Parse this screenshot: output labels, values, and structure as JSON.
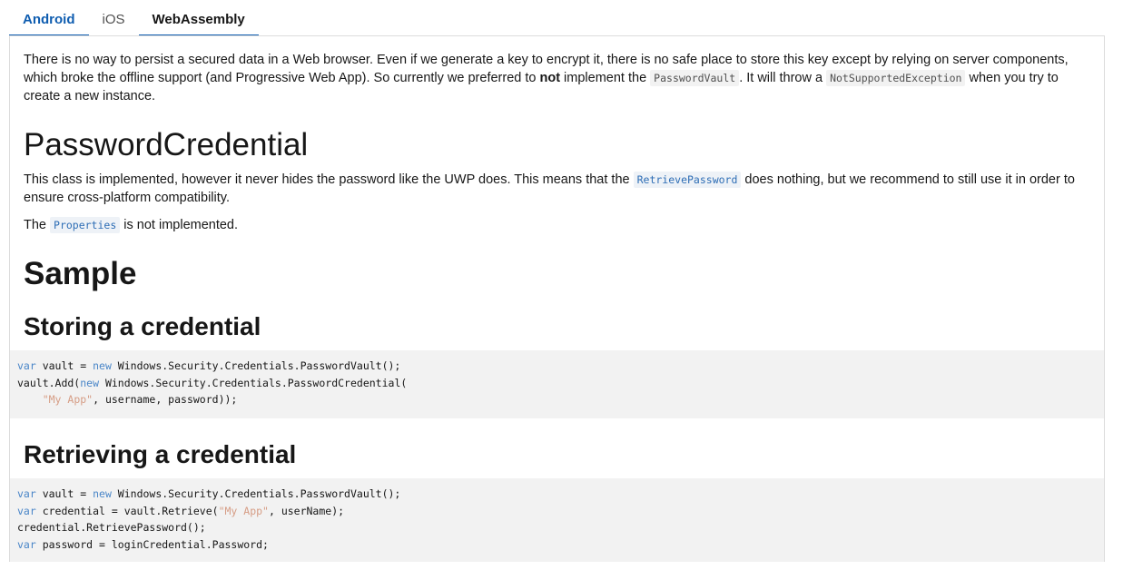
{
  "tabs": [
    {
      "label": "Android"
    },
    {
      "label": "iOS"
    },
    {
      "label": "WebAssembly"
    }
  ],
  "intro": {
    "text_1": "There is no way to persist a secured data in a Web browser. Even if we generate a key to encrypt it, there is no safe place to store this key except by relying on server components, which broke the offline support (and Progressive Web App). So currently we preferred to ",
    "bold": "not",
    "text_2": " implement the ",
    "code_1": "PasswordVault",
    "text_3": ". It will throw a ",
    "code_2": "NotSupportedException",
    "text_4": " when you try to create a new instance."
  },
  "password_credential": {
    "heading": "PasswordCredential",
    "p1_text_1": "This class is implemented, however it never hides the password like the UWP does. This means that the ",
    "p1_code": "RetrievePassword",
    "p1_text_2": " does nothing, but we recommend to still use it in order to ensure cross-platform compatibility.",
    "p2_text_1": "The ",
    "p2_code": "Properties",
    "p2_text_2": " is not implemented."
  },
  "sample": {
    "heading": "Sample",
    "storing_heading": "Storing a credential",
    "storing_code": {
      "l1_kw": "var",
      "l1_rest_a": " vault = ",
      "l1_kw2": "new",
      "l1_rest_b": " Windows.Security.Credentials.PasswordVault();",
      "l2_a": "vault.Add(",
      "l2_kw": "new",
      "l2_b": " Windows.Security.Credentials.PasswordCredential(",
      "l3_indent": "    ",
      "l3_str": "\"My App\"",
      "l3_rest": ", username, password));"
    },
    "retrieving_heading": "Retrieving a credential",
    "retrieving_code": {
      "l1_kw": "var",
      "l1_rest_a": " vault = ",
      "l1_kw2": "new",
      "l1_rest_b": " Windows.Security.Credentials.PasswordVault();",
      "l2_kw": "var",
      "l2_a": " credential = vault.Retrieve(",
      "l2_str": "\"My App\"",
      "l2_b": ", userName);",
      "l3": "credential.RetrievePassword();",
      "l4_kw": "var",
      "l4_rest": " password = loginCredential.Password;"
    }
  }
}
